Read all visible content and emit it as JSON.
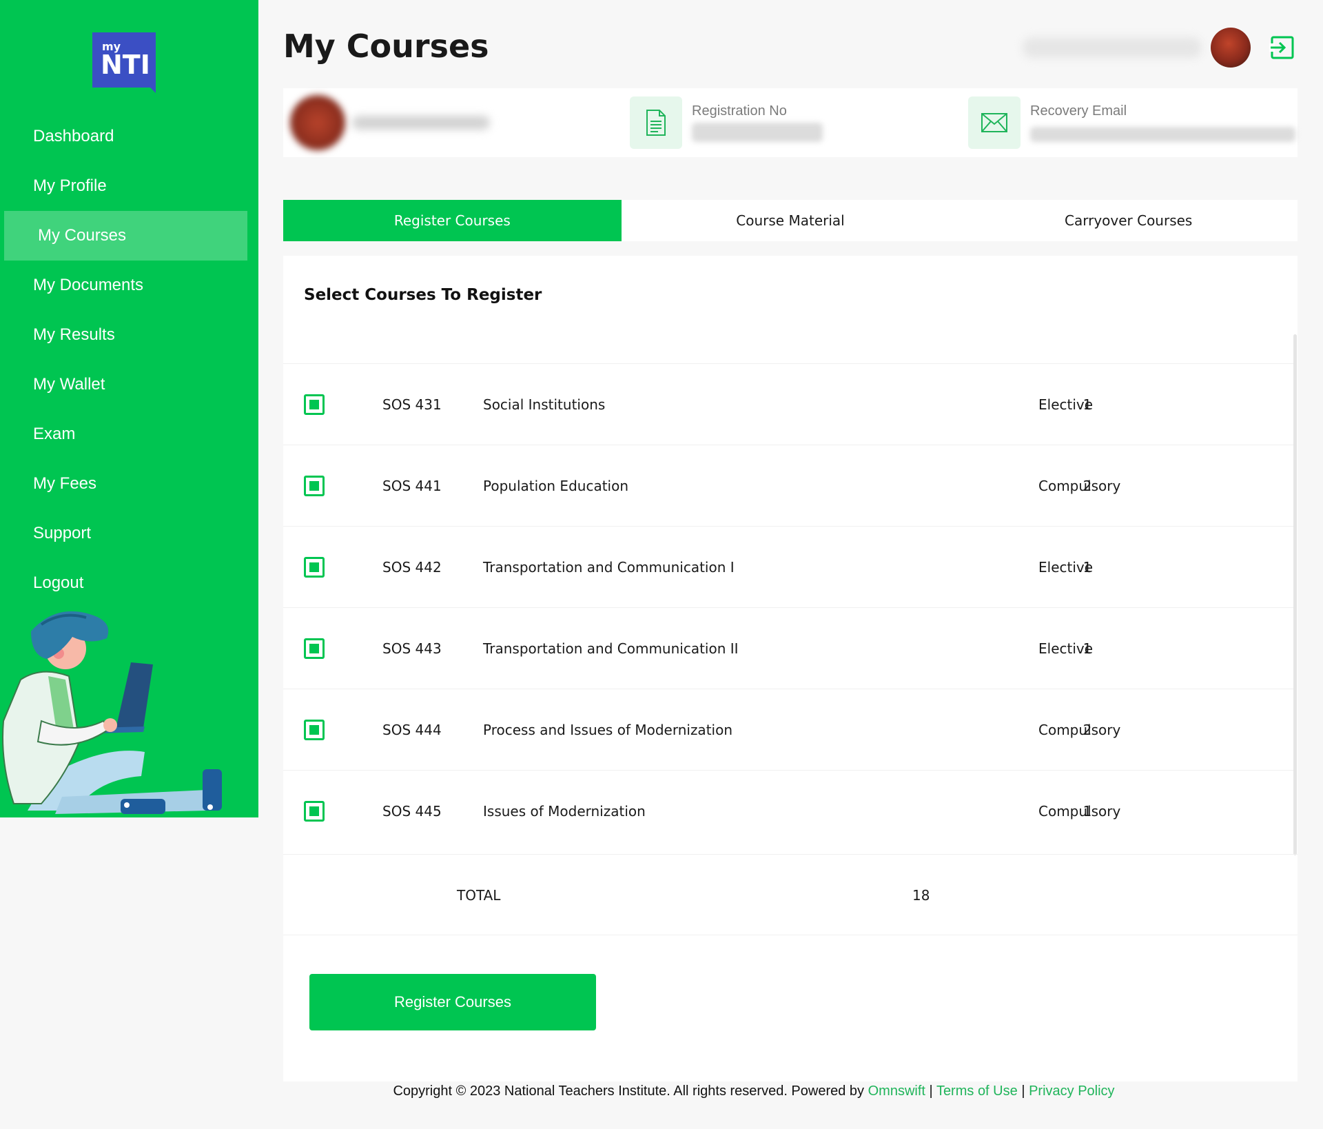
{
  "sidebar": {
    "logo_text_small": "my",
    "logo_text_big": "NTI",
    "items": [
      {
        "label": "Dashboard"
      },
      {
        "label": "My Profile"
      },
      {
        "label": "My Courses",
        "active": true
      },
      {
        "label": "My Documents"
      },
      {
        "label": "My Results"
      },
      {
        "label": "My Wallet"
      },
      {
        "label": "Exam"
      },
      {
        "label": "My Fees"
      },
      {
        "label": "Support"
      },
      {
        "label": "Logout"
      }
    ]
  },
  "header": {
    "title": "My Courses"
  },
  "profile": {
    "registration_label": "Registration No",
    "recovery_email_label": "Recovery Email"
  },
  "tabs": [
    {
      "label": "Register Courses",
      "active": true
    },
    {
      "label": "Course Material"
    },
    {
      "label": "Carryover Courses"
    }
  ],
  "courses_card": {
    "title": "Select Courses To Register",
    "rows": [
      {
        "code": "SOS 431",
        "title": "Social Institutions",
        "units": "1",
        "type": "Elective"
      },
      {
        "code": "SOS 441",
        "title": "Population Education",
        "units": "2",
        "type": "Compulsory"
      },
      {
        "code": "SOS 442",
        "title": "Transportation and Communication I",
        "units": "1",
        "type": "Elective"
      },
      {
        "code": "SOS 443",
        "title": "Transportation and Communication II",
        "units": "1",
        "type": "Elective"
      },
      {
        "code": "SOS 444",
        "title": "Process and Issues of Modernization",
        "units": "2",
        "type": "Compulsory"
      },
      {
        "code": "SOS 445",
        "title": "Issues of Modernization",
        "units": "1",
        "type": "Compulsory"
      }
    ],
    "total_label": "TOTAL",
    "total_value": "18",
    "submit_label": "Register Courses"
  },
  "footer": {
    "text": "Copyright © 2023 National Teachers Institute. All rights reserved. Powered by",
    "powered_by": "Omnswift",
    "sep": "|",
    "terms": "Terms of Use",
    "privacy": "Privacy Policy"
  },
  "colors": {
    "brand_green": "#00c551",
    "logo_blue": "#3b4fc4",
    "link_green": "#1fb45a"
  }
}
